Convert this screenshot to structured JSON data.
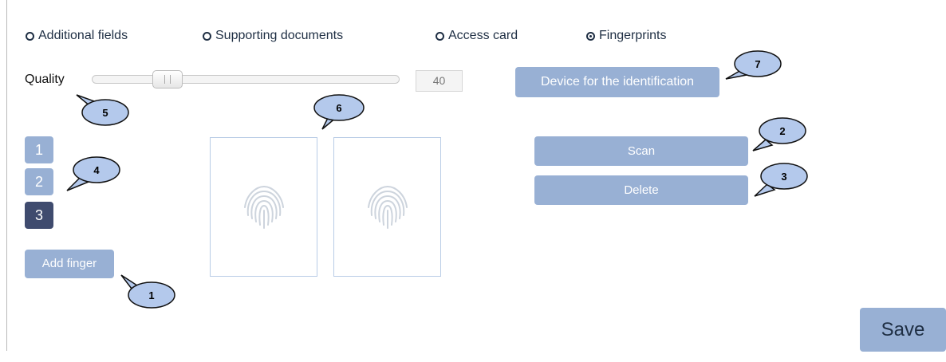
{
  "tabs": [
    {
      "label": "Additional fields",
      "selected": false
    },
    {
      "label": "Supporting documents",
      "selected": false
    },
    {
      "label": "Access card",
      "selected": false
    },
    {
      "label": "Fingerprints",
      "selected": true
    }
  ],
  "quality": {
    "label": "Quality",
    "value": "40"
  },
  "buttons": {
    "device": "Device for the identification",
    "scan": "Scan",
    "delete": "Delete",
    "add_finger": "Add finger",
    "save": "Save"
  },
  "fingers": [
    "1",
    "2",
    "3"
  ],
  "active_finger": "3",
  "fingerprint_icon": "fingerprint-icon",
  "callouts": [
    "1",
    "2",
    "3",
    "4",
    "5",
    "6",
    "7"
  ],
  "colors": {
    "button": "#98b0d4",
    "active_finger": "#3f4b6e",
    "callout_fill": "#b4c9ec",
    "text_dark": "#1f2f44"
  }
}
